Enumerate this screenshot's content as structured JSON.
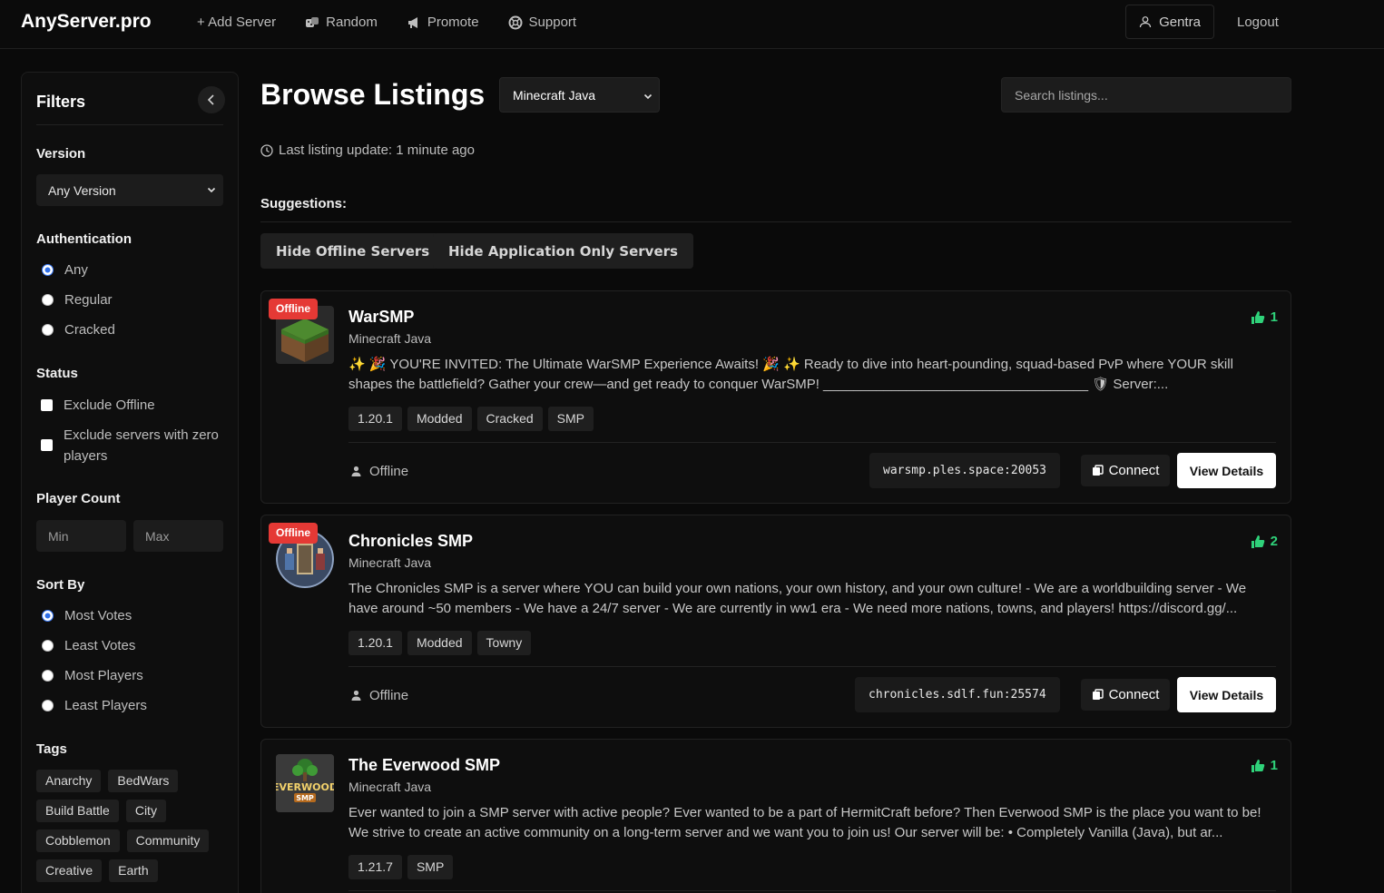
{
  "nav": {
    "brand": "AnyServer.pro",
    "links": [
      {
        "label": "+ Add Server",
        "icon": "none"
      },
      {
        "label": "Random",
        "icon": "dice-icon"
      },
      {
        "label": "Promote",
        "icon": "megaphone-icon"
      },
      {
        "label": "Support",
        "icon": "lifebuoy-icon"
      }
    ],
    "user": "Gentra",
    "logout": "Logout"
  },
  "sidebar": {
    "title": "Filters",
    "version_label": "Version",
    "version_value": "Any Version",
    "auth_label": "Authentication",
    "auth_options": [
      "Any",
      "Regular",
      "Cracked"
    ],
    "status_label": "Status",
    "status_options": [
      "Exclude Offline",
      "Exclude servers with zero players"
    ],
    "player_count_label": "Player Count",
    "min_placeholder": "Min",
    "max_placeholder": "Max",
    "sort_label": "Sort By",
    "sort_options": [
      "Most Votes",
      "Least Votes",
      "Most Players",
      "Least Players"
    ],
    "tags_label": "Tags",
    "tags": [
      "Anarchy",
      "BedWars",
      "Build Battle",
      "City",
      "Cobblemon",
      "Community",
      "Creative",
      "Earth"
    ]
  },
  "main": {
    "title": "Browse Listings",
    "game_select": "Minecraft Java",
    "search_placeholder": "Search listings...",
    "last_update": "Last listing update: 1 minute ago",
    "suggestions_label": "Suggestions:",
    "suggestions": [
      "Hide Offline Servers",
      "Hide Application Only Servers"
    ]
  },
  "listings": [
    {
      "status": "Offline",
      "name": "WarSMP",
      "game": "Minecraft Java",
      "votes": "1",
      "description": "✨ 🎉 YOU'RE INVITED: The Ultimate WarSMP Experience Awaits! 🎉 ✨ Ready to dive into heart-pounding, squad-based PvP where YOUR skill shapes the battlefield? Gather your crew—and get ready to conquer WarSMP! ___________________________________ 🛡 Server:...",
      "tags": [
        "1.20.1",
        "Modded",
        "Cracked",
        "SMP"
      ],
      "players": "Offline",
      "address": "warsmp.ples.space:20053",
      "connect": "Connect",
      "details": "View Details"
    },
    {
      "status": "Offline",
      "name": "Chronicles SMP",
      "game": "Minecraft Java",
      "votes": "2",
      "description": "The Chronicles SMP is a server where YOU can build your own nations, your own history, and your own culture! - We are a worldbuilding server - We have around ~50 members - We have a 24/7 server - We are currently in ww1 era - We need more nations, towns, and players! https://discord.gg/...",
      "tags": [
        "1.20.1",
        "Modded",
        "Towny"
      ],
      "players": "Offline",
      "address": "chronicles.sdlf.fun:25574",
      "connect": "Connect",
      "details": "View Details"
    },
    {
      "status": "",
      "name": "The Everwood SMP",
      "game": "Minecraft Java",
      "votes": "1",
      "description": "Ever wanted to join a SMP server with active people? Ever wanted to be a part of HermitCraft before? Then Everwood SMP is the place you want to be! We strive to create an active community on a long-term server and we want you to join us! Our server will be: • Completely Vanilla (Java), but ar...",
      "tags": [
        "1.21.7",
        "SMP"
      ],
      "logo_text": [
        "EVERWOOD",
        "SMP"
      ]
    }
  ]
}
